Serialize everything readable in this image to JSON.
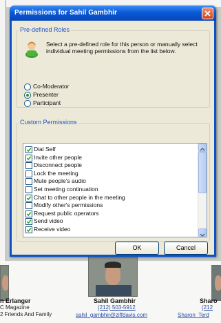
{
  "dialog": {
    "title": "Permissions for Sahil Gambhir",
    "predefined_legend": "Pre-defined Roles",
    "description": "Select a pre-defined role for this person or manually select individual meeting permissions from the list below.",
    "roles": [
      {
        "label": "Co-Moderator",
        "selected": false
      },
      {
        "label": "Presenter",
        "selected": true
      },
      {
        "label": "Participant",
        "selected": false
      }
    ],
    "custom_legend": "Custom Permissions",
    "permissions": [
      {
        "label": "Dial Self",
        "checked": true
      },
      {
        "label": "Invite other people",
        "checked": true
      },
      {
        "label": "Disconnect people",
        "checked": false
      },
      {
        "label": "Lock the meeting",
        "checked": false
      },
      {
        "label": "Mute people's audio",
        "checked": false
      },
      {
        "label": "Set meeting continuation",
        "checked": false
      },
      {
        "label": "Chat to other people in the meeting",
        "checked": true
      },
      {
        "label": "Modify other's permissions",
        "checked": false
      },
      {
        "label": "Request public operators",
        "checked": true
      },
      {
        "label": "Send video",
        "checked": true
      },
      {
        "label": "Receive video",
        "checked": true
      }
    ],
    "ok_label": "OK",
    "cancel_label": "Cancel"
  },
  "people": [
    {
      "name": "n Erlanger",
      "line2": "C Magazine",
      "line3": "2 Friends And Family"
    },
    {
      "name": "Sahil Gambhir",
      "phone": "(212) 503-5912",
      "email": "sahil_gambhir@ziffdavis.com"
    },
    {
      "name": "Sharo",
      "phone": "(212",
      "email": "Sharon_Terd"
    }
  ],
  "colors": {
    "title_bar": "#0a5ad8",
    "dialog_face": "#ece9d8",
    "legend_text": "#2453c5",
    "link": "#2a4fa8"
  }
}
